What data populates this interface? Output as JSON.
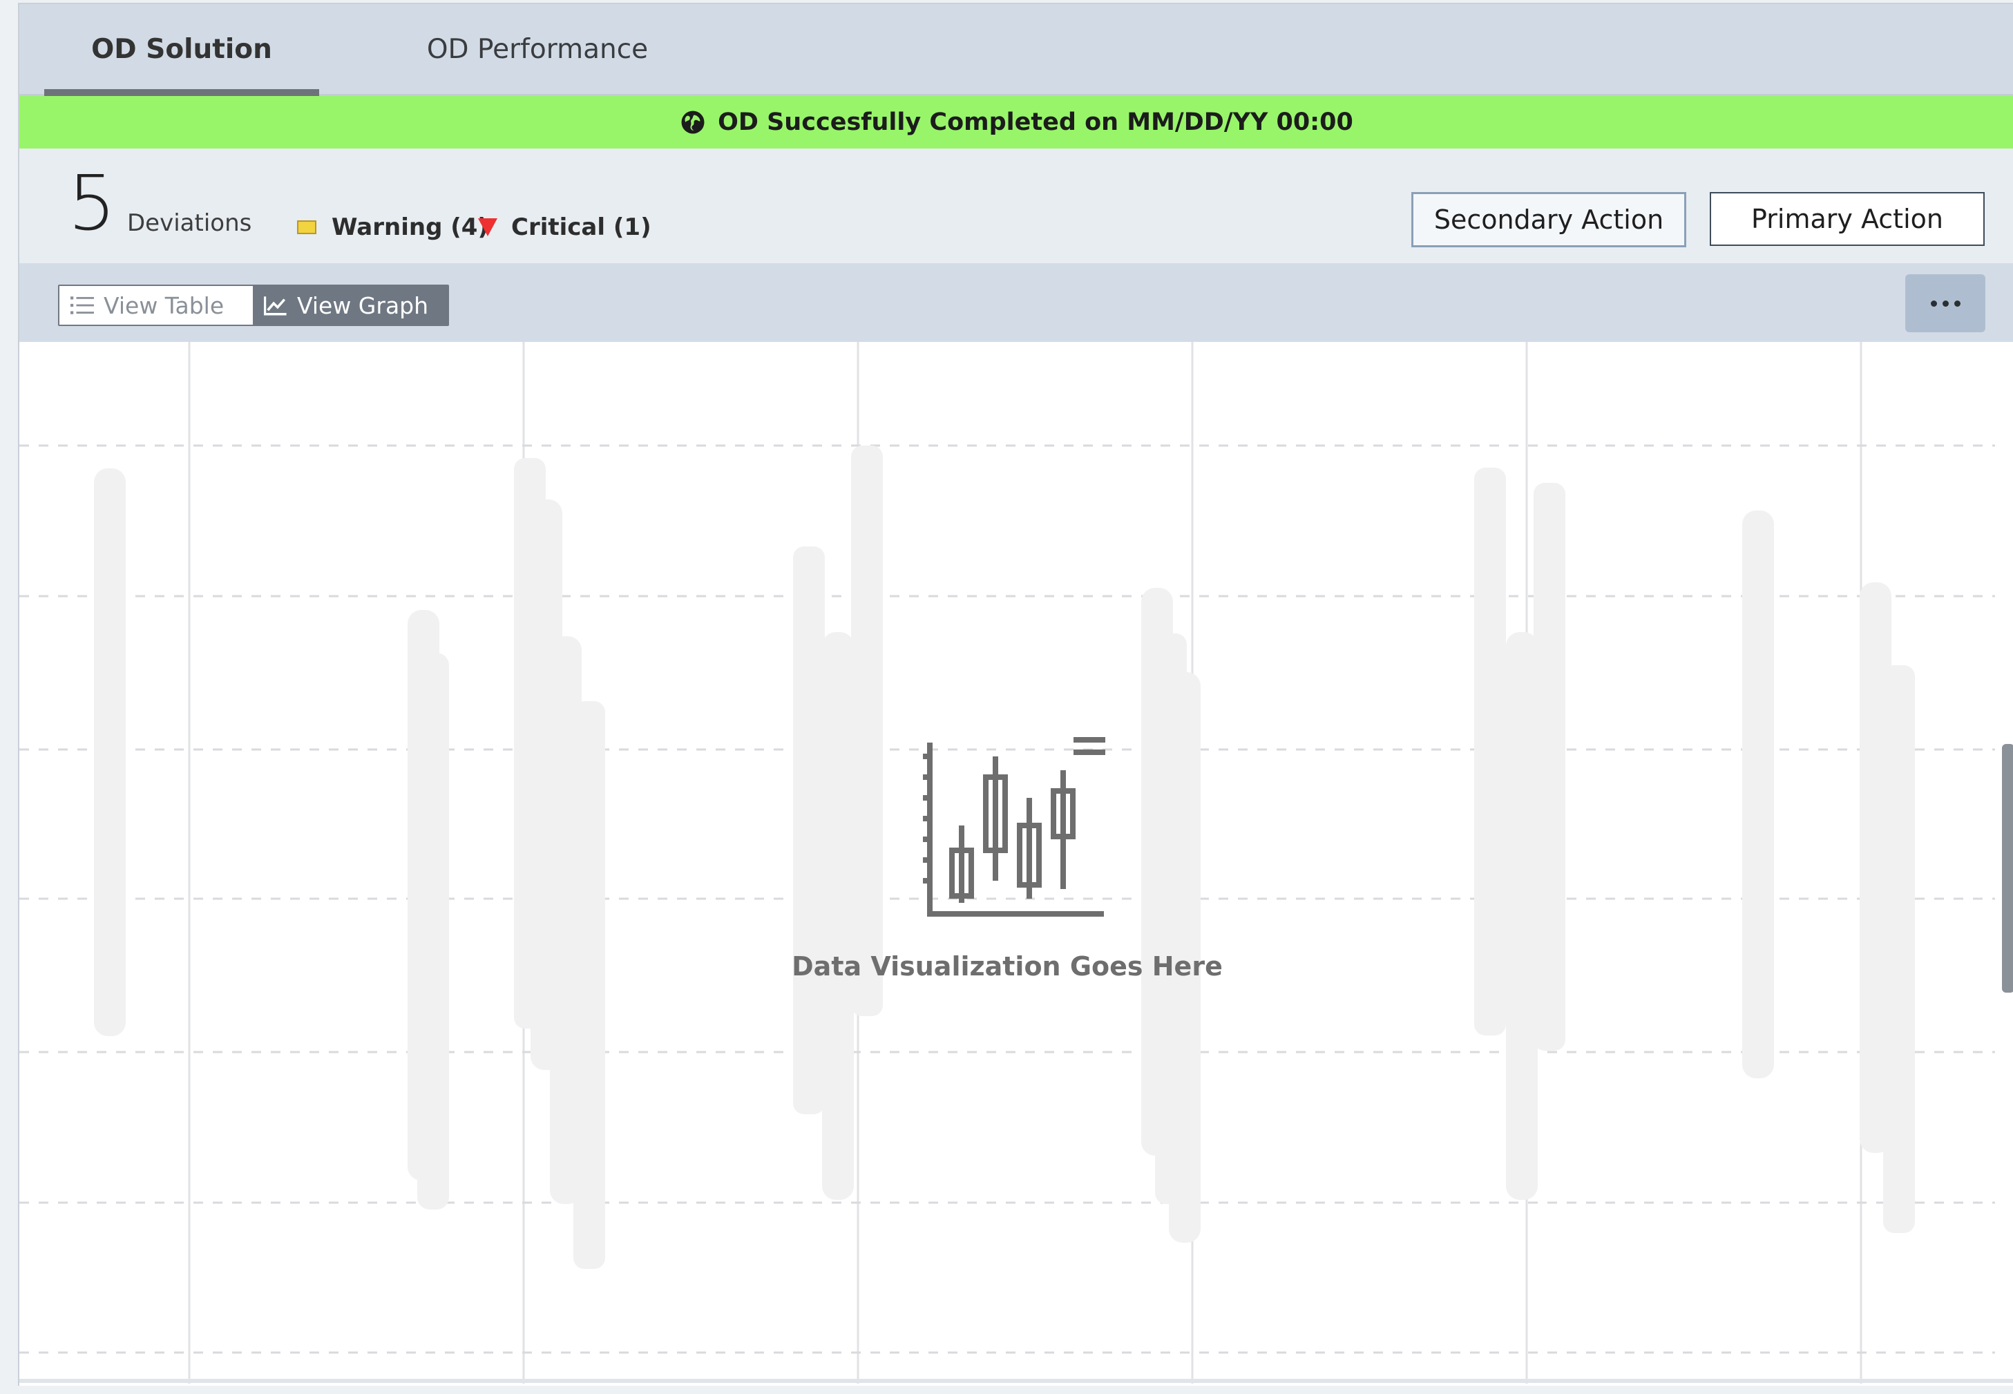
{
  "tabs": [
    {
      "label": "OD Solution",
      "active": true
    },
    {
      "label": "OD Performance",
      "active": false
    }
  ],
  "banner": {
    "icon": "globe-icon",
    "text": "OD Succesfully Completed on MM/DD/YY 00:00",
    "color": "#98f56a"
  },
  "summary": {
    "count": "5",
    "count_label": "Deviations",
    "warning_label": "Warning (4)",
    "critical_label": "Critical (1)",
    "warning_color": "#f2d340",
    "critical_color": "#ee3030"
  },
  "actions": {
    "secondary": "Secondary Action",
    "primary": "Primary Action"
  },
  "view_toggle": {
    "table": "View Table",
    "graph": "View Graph",
    "selected": "graph"
  },
  "more_menu": {
    "icon": "more-horizontal-icon"
  },
  "chart": {
    "placeholder_text": "Data Visualization Goes Here",
    "placeholder_icon": "candlestick-chart-icon"
  }
}
